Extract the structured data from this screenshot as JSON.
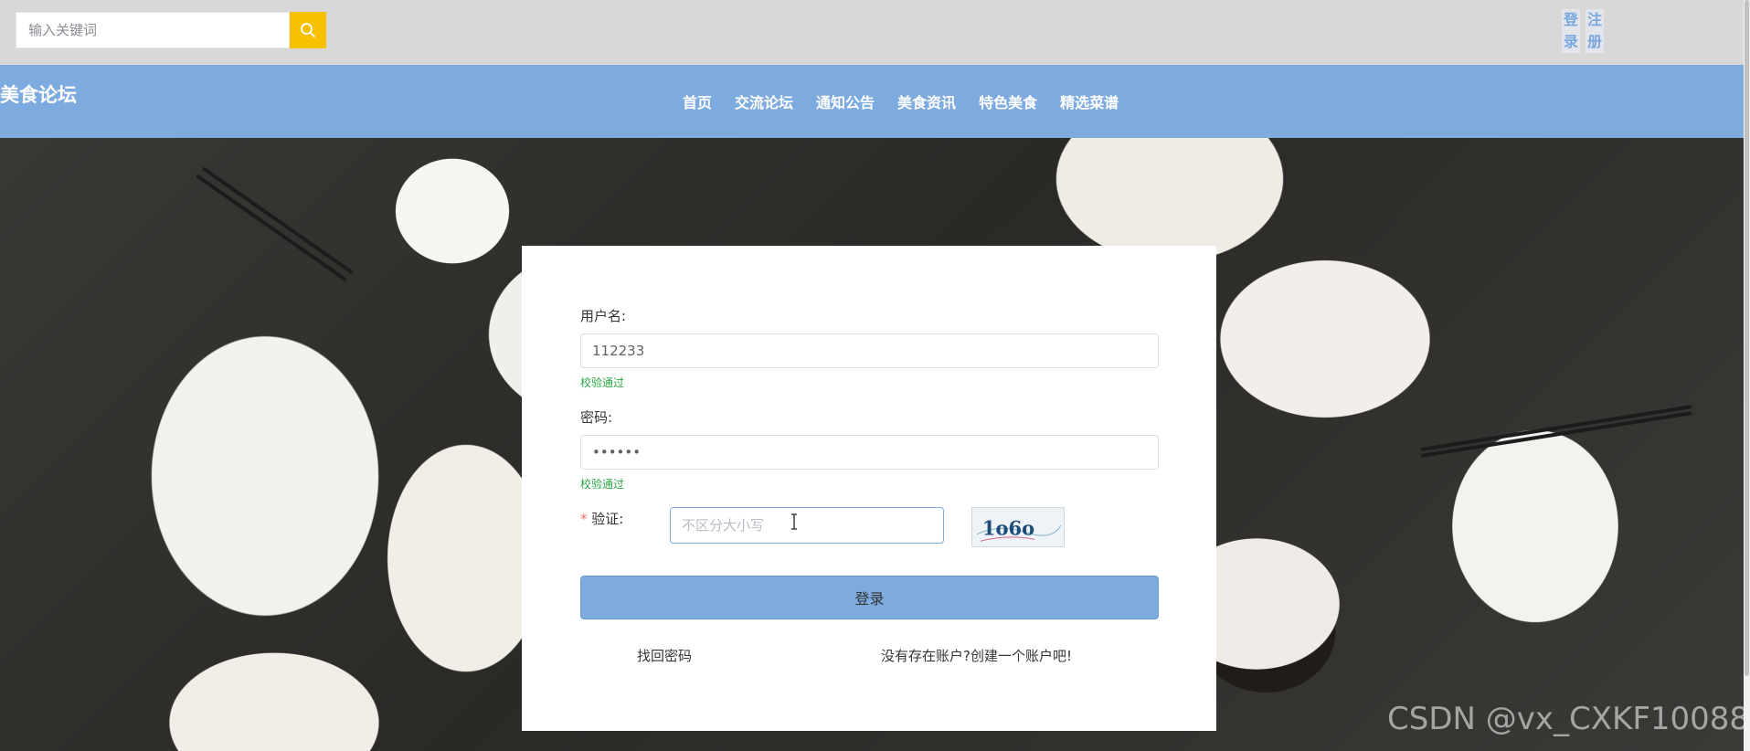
{
  "search": {
    "placeholder": "输入关键词"
  },
  "auth": {
    "login_label": "登录",
    "register_label": "注册"
  },
  "brand": {
    "title": "美食论坛"
  },
  "nav": {
    "items": [
      "首页",
      "交流论坛",
      "通知公告",
      "美食资讯",
      "特色美食",
      "精选菜谱"
    ]
  },
  "login_form": {
    "username_label": "用户名:",
    "username_value": "112233",
    "username_status": "校验通过",
    "password_label": "密码:",
    "password_value": "••••••",
    "password_status": "校验通过",
    "captcha_required_mark": "*",
    "captcha_label": "验证:",
    "captcha_placeholder": "不区分大小写",
    "captcha_code": "1o6o",
    "submit_label": "登录",
    "forgot_password": "找回密码",
    "register_link": "没有存在账户?创建一个账户吧!"
  },
  "watermark": "CSDN @vx_CXKF10088",
  "colors": {
    "nav_bg": "#7eabdf",
    "search_button": "#f8c100",
    "success": "#28a745",
    "topbar_bg": "#d8d8d8"
  }
}
